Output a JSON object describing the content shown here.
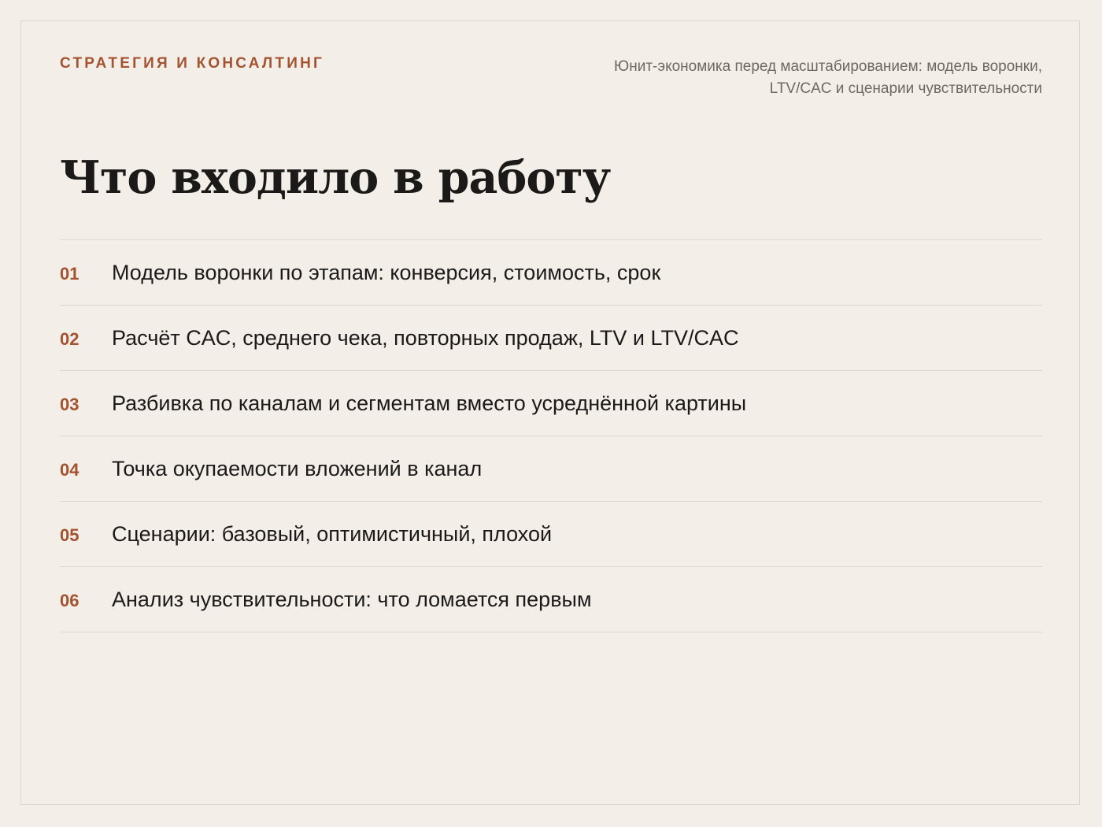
{
  "header": {
    "brand": "СТРАТЕГИЯ И КОНСАЛТИНГ",
    "subtitle_line1": "Юнит-экономика перед масштабированием: модель воронки,",
    "subtitle_line2": "LTV/CAC и сценарии чувствительности"
  },
  "title": "Что входило в работу",
  "items": [
    {
      "number": "01",
      "text": "Модель воронки по этапам: конверсия, стоимость, срок"
    },
    {
      "number": "02",
      "text": "Расчёт CAC, среднего чека, повторных продаж, LTV и LTV/CAC"
    },
    {
      "number": "03",
      "text": "Разбивка по каналам и сегментам вместо усреднённой картины"
    },
    {
      "number": "04",
      "text": "Точка окупаемости вложений в канал"
    },
    {
      "number": "05",
      "text": "Сценарии: базовый, оптимистичный, плохой"
    },
    {
      "number": "06",
      "text": "Анализ чувствительности: что ломается первым"
    }
  ],
  "colors": {
    "background": "#f3eee8",
    "accent": "#a3532f",
    "text": "#1c1a18",
    "muted": "#6e6862",
    "divider": "#dcd6cf"
  }
}
